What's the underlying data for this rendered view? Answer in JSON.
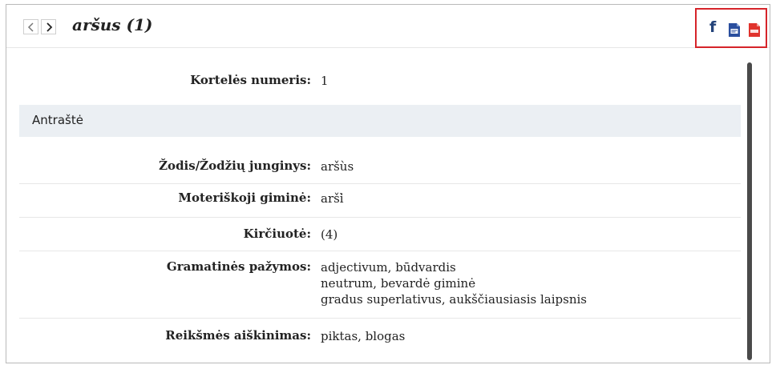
{
  "header": {
    "title": "aršus (1)",
    "prev_icon": "chevron-left-icon",
    "next_icon": "chevron-right-icon"
  },
  "share": {
    "facebook_glyph": "f",
    "icons": [
      "facebook-icon",
      "word-document-icon",
      "pdf-document-icon"
    ],
    "facebook_color": "#24437a",
    "word_color": "#2b4f9e",
    "pdf_color": "#e0332d",
    "highlight_color": "#d6242a"
  },
  "card": {
    "label": "Kortelės numeris:",
    "value": "1"
  },
  "section": {
    "title": "Antraštė"
  },
  "fields": [
    {
      "label": "Žodis/Žodžių junginys:",
      "value": "aršùs"
    },
    {
      "label": "Moteriškoji giminė:",
      "value": "arši̇̀"
    },
    {
      "label": "Kirčiuotė:",
      "value": "(4)"
    },
    {
      "label": "Gramatinės pažymos:",
      "lines": [
        "adjectivum, būdvardis",
        "neutrum, bevardė giminė",
        "gradus superlativus, aukščiausiasis laipsnis"
      ]
    },
    {
      "label": "Reikšmės aiškinimas:",
      "value": "piktas, blogas"
    }
  ]
}
